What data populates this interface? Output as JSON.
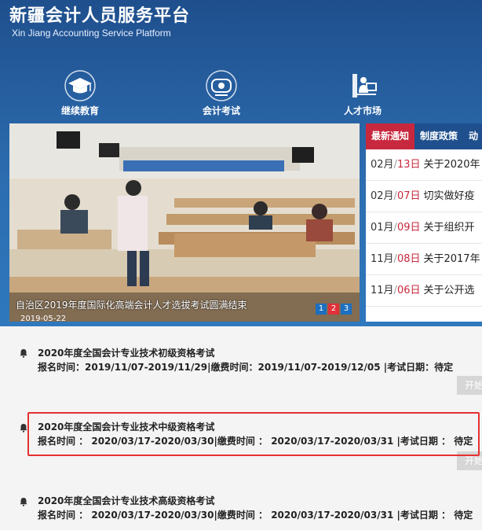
{
  "header": {
    "title": "新疆会计人员服务平台",
    "subtitle": "Xin Jiang Accounting Service Platform"
  },
  "nav": [
    {
      "label": "继续教育",
      "icon": "graduation-cap-icon"
    },
    {
      "label": "会计考试",
      "icon": "exam-paper-icon"
    },
    {
      "label": "人才市场",
      "icon": "person-computer-icon"
    }
  ],
  "slider": {
    "caption": "自治区2019年度国际化高端会计人才选拔考试圆满结束",
    "date": "2019-05-22",
    "pages": [
      "1",
      "2",
      "3"
    ],
    "active_page": "2"
  },
  "news": {
    "tabs": [
      "最新通知",
      "制度政策",
      "动"
    ],
    "items": [
      {
        "month": "02月",
        "day": "13日",
        "title": "关于2020年"
      },
      {
        "month": "02月",
        "day": "07日",
        "title": "切实做好疫"
      },
      {
        "month": "01月",
        "day": "09日",
        "title": "关于组织开"
      },
      {
        "month": "11月",
        "day": "08日",
        "title": "关于2017年"
      },
      {
        "month": "11月",
        "day": "06日",
        "title": "关于公开选"
      }
    ]
  },
  "exams": [
    {
      "title": "2020年度全国会计专业技术初级资格考试",
      "line": "报名时间：2019/11/07-2019/11/29|缴费时间：2019/11/07-2019/12/05 |考试日期：待定",
      "button": "开始"
    },
    {
      "title": "2020年度全国会计专业技术中级资格考试",
      "line": "报名时间 ： 2020/03/17-2020/03/30|缴费时间 ： 2020/03/17-2020/03/31 |考试日期 ： 待定",
      "button": "开始"
    },
    {
      "title": "2020年度全国会计专业技术高级资格考试",
      "line": "报名时间 ： 2020/03/17-2020/03/30|缴费时间 ： 2020/03/17-2020/03/31 |考试日期 ： 待定",
      "button": ""
    }
  ],
  "colors": {
    "header": "#2c6db0",
    "accent_red": "#c8283d",
    "tab_blue": "#1f4f8d",
    "highlight": "#e53030"
  }
}
